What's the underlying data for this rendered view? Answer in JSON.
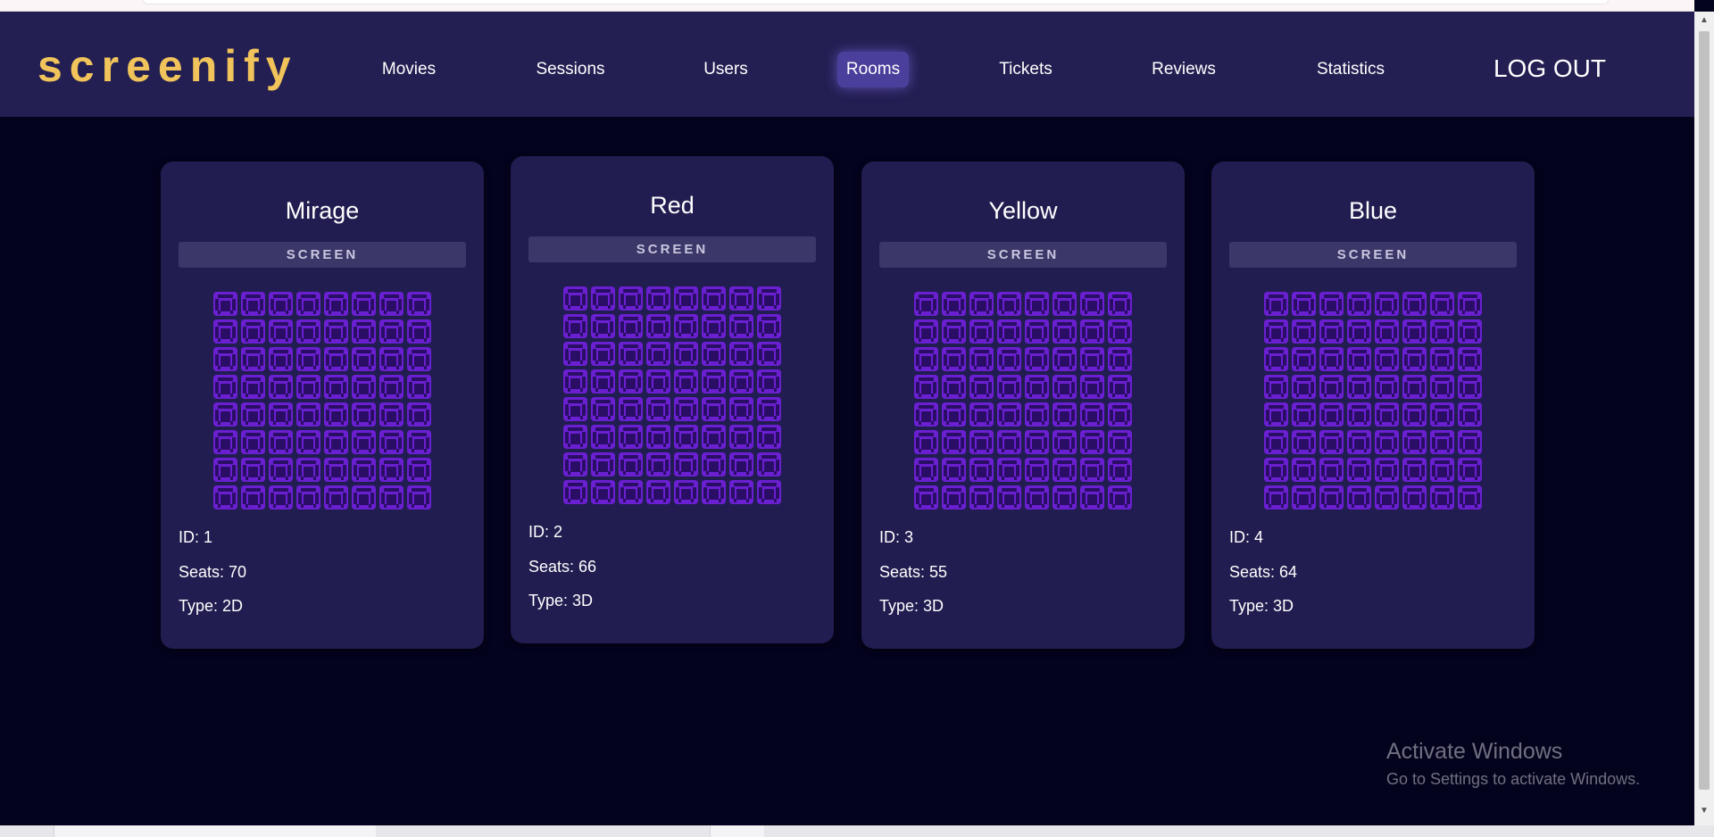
{
  "app": {
    "logo": "screenify"
  },
  "nav": {
    "items": [
      {
        "label": "Movies"
      },
      {
        "label": "Sessions"
      },
      {
        "label": "Users"
      },
      {
        "label": "Rooms",
        "active": true
      },
      {
        "label": "Tickets"
      },
      {
        "label": "Reviews"
      },
      {
        "label": "Statistics"
      }
    ],
    "logout_label": "LOG OUT"
  },
  "rooms": [
    {
      "name": "Mirage",
      "screen_label": "SCREEN",
      "id_text": "ID: 1",
      "seats_text": "Seats: 70",
      "type_text": "Type: 2D",
      "seat_rows": 8,
      "seat_cols": 8
    },
    {
      "name": "Red",
      "screen_label": "SCREEN",
      "id_text": "ID: 2",
      "seats_text": "Seats: 66",
      "type_text": "Type: 3D",
      "seat_rows": 8,
      "seat_cols": 8
    },
    {
      "name": "Yellow",
      "screen_label": "SCREEN",
      "id_text": "ID: 3",
      "seats_text": "Seats: 55",
      "type_text": "Type: 3D",
      "seat_rows": 8,
      "seat_cols": 8
    },
    {
      "name": "Blue",
      "screen_label": "SCREEN",
      "id_text": "ID: 4",
      "seats_text": "Seats: 64",
      "type_text": "Type: 3D",
      "seat_rows": 8,
      "seat_cols": 8
    }
  ],
  "watermark": {
    "title": "Activate Windows",
    "subtitle": "Go to Settings to activate Windows."
  },
  "colors": {
    "background": "#04031e",
    "navbar": "#231f52",
    "card": "#211d50",
    "logo": "#f1c35b",
    "seat": "#6a1fd0",
    "active_nav": "#4a3f9a"
  },
  "icons": {
    "seat": "seat-icon"
  }
}
